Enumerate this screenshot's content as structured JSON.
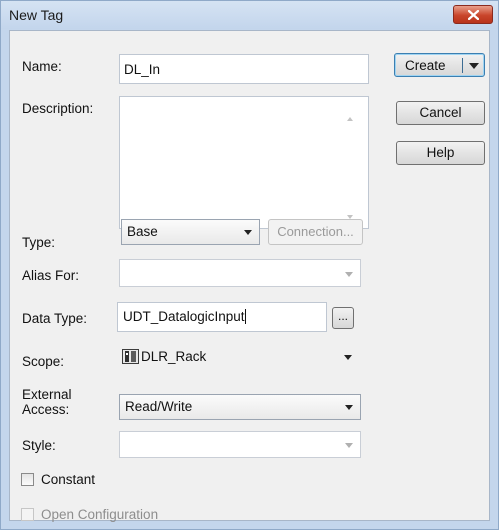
{
  "window": {
    "title": "New Tag"
  },
  "fields": {
    "name": {
      "label": "Name:",
      "value": "DL_In"
    },
    "description": {
      "label": "Description:",
      "value": ""
    },
    "type": {
      "label": "Type:",
      "value": "Base"
    },
    "alias_for": {
      "label": "Alias For:",
      "value": ""
    },
    "data_type": {
      "label": "Data Type:",
      "value": "UDT_DatalogicInput"
    },
    "scope": {
      "label": "Scope:",
      "value": "DLR_Rack"
    },
    "external_access": {
      "label_line1": "External",
      "label_line2": "Access:",
      "value": "Read/Write"
    },
    "style": {
      "label": "Style:",
      "value": ""
    }
  },
  "buttons": {
    "connection": "Connection...",
    "browse": "...",
    "create": "Create",
    "cancel": "Cancel",
    "help": "Help"
  },
  "checkboxes": {
    "constant": {
      "label": "Constant",
      "checked": false
    },
    "open_configuration": {
      "label": "Open Configuration",
      "checked": false,
      "enabled": false
    }
  },
  "icons": {
    "close": "close-icon",
    "scope": "controller-icon"
  },
  "colors": {
    "title_bar": "#c4d6ec",
    "close_button": "#c9452b",
    "client": "#f0f0f0"
  }
}
